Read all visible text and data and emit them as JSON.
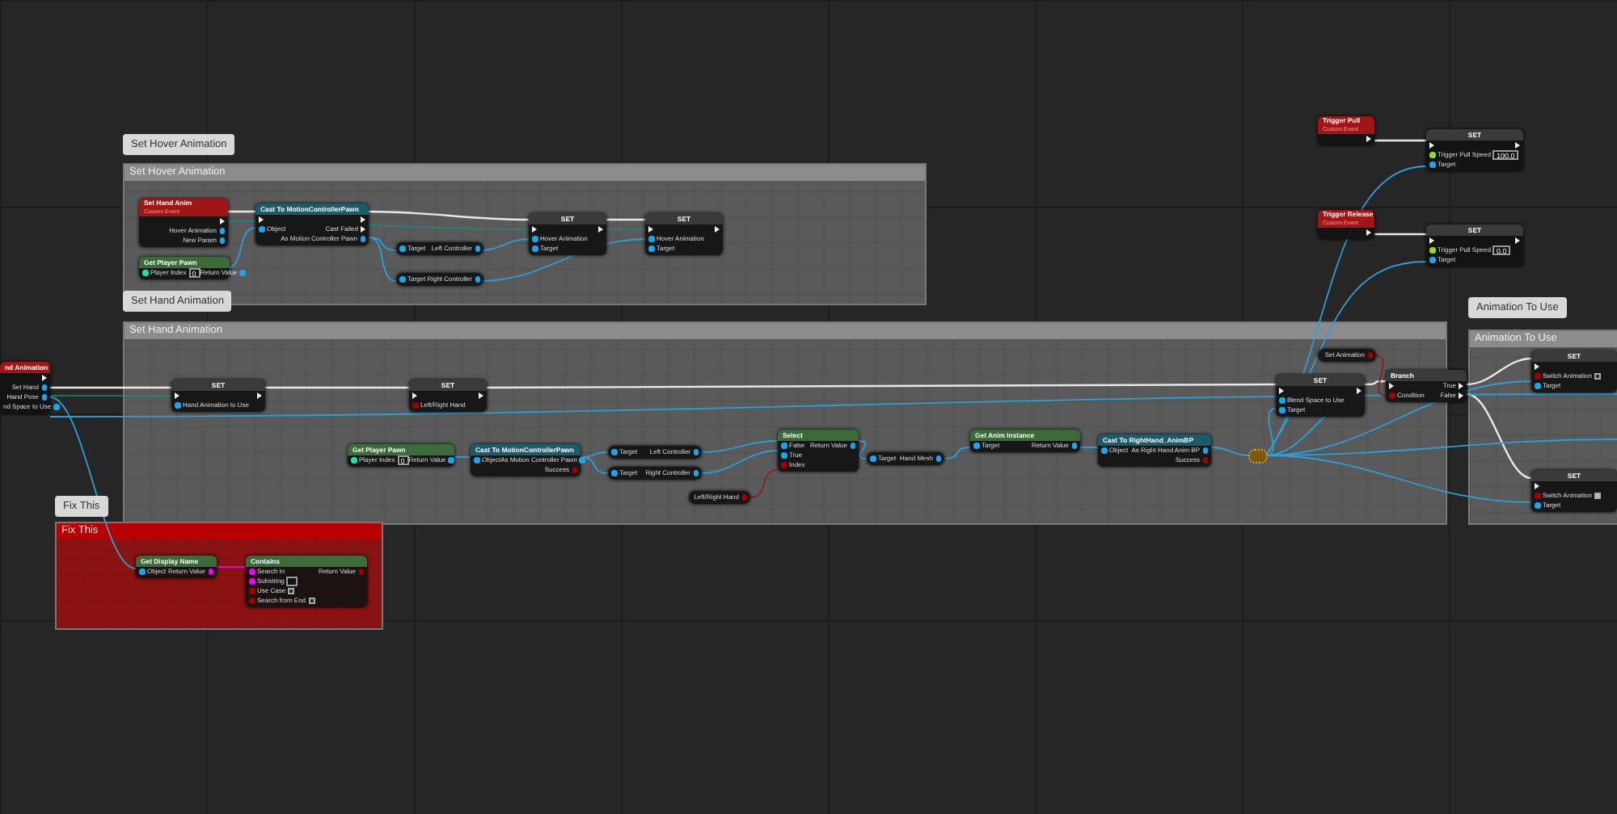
{
  "comments": [
    {
      "title": "Set Hover Animation",
      "bubble": "Set Hover Animation",
      "color": "#5a5a5a"
    },
    {
      "title": "Set Hand Animation",
      "bubble": "Set Hand Animation",
      "color": "#5a5a5a"
    },
    {
      "title": "Fix This",
      "bubble": "Fix This",
      "color": "#8a1212"
    },
    {
      "title": "Animation To Use",
      "bubble": "Animation To Use",
      "color": "#5a5a5a"
    }
  ],
  "nodes": [
    {
      "kind": "event",
      "title": "Set Hand Anim",
      "subtitle": "Custom Event",
      "selected": false,
      "outputs": [
        {
          "kind": "exec"
        },
        {
          "label": "Hover Animation",
          "kind": "object"
        },
        {
          "label": "New Param",
          "kind": "object"
        }
      ]
    },
    {
      "kind": "pure",
      "title": "Get Player Pawn",
      "selected": false,
      "inputs": [
        {
          "label": "Player Index",
          "kind": "int",
          "value": "0"
        }
      ],
      "outputs": [
        {
          "label": "Return Value",
          "kind": "object"
        }
      ]
    },
    {
      "kind": "cast",
      "title": "Cast To MotionControllerPawn",
      "selected": false,
      "inputs": [
        {
          "kind": "exec"
        },
        {
          "label": "Object",
          "kind": "object"
        }
      ],
      "outputs": [
        {
          "kind": "exec"
        },
        {
          "label": "Cast Failed",
          "kind": "exec"
        },
        {
          "label": "As Motion Controller Pawn",
          "kind": "object"
        }
      ]
    },
    {
      "kind": "getter",
      "selected": false,
      "inputs": [
        {
          "label": "Target",
          "kind": "object"
        }
      ],
      "outputs": [
        {
          "label": "Left Controller",
          "kind": "object"
        }
      ]
    },
    {
      "kind": "getter",
      "selected": false,
      "inputs": [
        {
          "label": "Target",
          "kind": "object"
        }
      ],
      "outputs": [
        {
          "label": "Right Controller",
          "kind": "object"
        }
      ]
    },
    {
      "kind": "set",
      "title": "SET",
      "selected": false,
      "inputs": [
        {
          "kind": "exec"
        },
        {
          "label": "Hover Animation",
          "kind": "object"
        },
        {
          "label": "Target",
          "kind": "object"
        }
      ],
      "outputs": [
        {
          "kind": "exec"
        }
      ]
    },
    {
      "kind": "set",
      "title": "SET",
      "selected": false,
      "inputs": [
        {
          "kind": "exec"
        },
        {
          "label": "Hover Animation",
          "kind": "object"
        },
        {
          "label": "Target",
          "kind": "object"
        }
      ],
      "outputs": [
        {
          "kind": "exec"
        }
      ]
    },
    {
      "kind": "event",
      "title": "nd Animation",
      "selected": false,
      "outputs": [
        {
          "kind": "exec"
        },
        {
          "label": "Set Hand",
          "kind": "object"
        },
        {
          "label": "Hand Pose",
          "kind": "object"
        },
        {
          "label": "nd Space to Use",
          "kind": "object"
        }
      ]
    },
    {
      "kind": "set",
      "title": "SET",
      "selected": false,
      "inputs": [
        {
          "kind": "exec"
        },
        {
          "label": "Hand Animation to Use",
          "kind": "object"
        }
      ],
      "outputs": [
        {
          "kind": "exec"
        }
      ]
    },
    {
      "kind": "set",
      "title": "SET",
      "selected": false,
      "inputs": [
        {
          "kind": "exec"
        },
        {
          "label": "Left/Right Hand",
          "kind": "bool"
        }
      ],
      "outputs": [
        {
          "kind": "exec"
        }
      ]
    },
    {
      "kind": "pure",
      "title": "Get Player Pawn",
      "selected": false,
      "inputs": [
        {
          "label": "Player Index",
          "kind": "int",
          "value": "0"
        }
      ],
      "outputs": [
        {
          "label": "Return Value",
          "kind": "object"
        }
      ]
    },
    {
      "kind": "cast",
      "title": "Cast To MotionControllerPawn",
      "selected": false,
      "inputs": [
        {
          "label": "Object",
          "kind": "object"
        }
      ],
      "outputs": [
        {
          "label": "As Motion Controller Pawn",
          "kind": "object"
        },
        {
          "label": "Success",
          "kind": "bool"
        }
      ]
    },
    {
      "kind": "getter",
      "selected": false,
      "inputs": [
        {
          "label": "Target",
          "kind": "object"
        }
      ],
      "outputs": [
        {
          "label": "Left Controller",
          "kind": "object"
        }
      ]
    },
    {
      "kind": "getter",
      "selected": false,
      "inputs": [
        {
          "label": "Target",
          "kind": "object"
        }
      ],
      "outputs": [
        {
          "label": "Right Controller",
          "kind": "object"
        }
      ]
    },
    {
      "kind": "getter",
      "selected": false,
      "outputs": [
        {
          "label": "Left/Right Hand",
          "kind": "bool"
        }
      ]
    },
    {
      "kind": "pure",
      "title": "Select",
      "selected": false,
      "inputs": [
        {
          "label": "False",
          "kind": "object"
        },
        {
          "label": "True",
          "kind": "object"
        },
        {
          "label": "Index",
          "kind": "bool"
        }
      ],
      "outputs": [
        {
          "label": "Return Value",
          "kind": "object"
        }
      ]
    },
    {
      "kind": "getter",
      "selected": false,
      "inputs": [
        {
          "label": "Target",
          "kind": "object"
        }
      ],
      "outputs": [
        {
          "label": "Hand Mesh",
          "kind": "object"
        }
      ]
    },
    {
      "kind": "pure",
      "title": "Get Anim Instance",
      "selected": false,
      "inputs": [
        {
          "label": "Target",
          "kind": "object"
        }
      ],
      "outputs": [
        {
          "label": "Return Value",
          "kind": "object"
        }
      ]
    },
    {
      "kind": "cast",
      "title": "Cast To RightHand_AnimBP",
      "selected": false,
      "inputs": [
        {
          "label": "Object",
          "kind": "object"
        }
      ],
      "outputs": [
        {
          "label": "As Right Hand Anim BP",
          "kind": "object"
        },
        {
          "label": "Success",
          "kind": "bool"
        }
      ]
    },
    {
      "kind": "reroute",
      "selected": true
    },
    {
      "kind": "getter",
      "selected": false,
      "outputs": [
        {
          "label": "Set Animation",
          "kind": "bool"
        }
      ]
    },
    {
      "kind": "set",
      "title": "SET",
      "selected": false,
      "inputs": [
        {
          "kind": "exec"
        },
        {
          "label": "Blend Space to Use",
          "kind": "object"
        },
        {
          "label": "Target",
          "kind": "object"
        }
      ],
      "outputs": [
        {
          "kind": "exec"
        }
      ]
    },
    {
      "kind": "branch",
      "title": "Branch",
      "selected": false,
      "inputs": [
        {
          "kind": "exec"
        },
        {
          "label": "Condition",
          "kind": "bool"
        }
      ],
      "outputs": [
        {
          "label": "True",
          "kind": "exec"
        },
        {
          "label": "False",
          "kind": "exec"
        }
      ]
    },
    {
      "kind": "set",
      "title": "SET",
      "selected": false,
      "inputs": [
        {
          "kind": "exec"
        },
        {
          "label": "Switch Animation",
          "kind": "bool",
          "checked": false
        },
        {
          "label": "Target",
          "kind": "object"
        }
      ]
    },
    {
      "kind": "set",
      "title": "SET",
      "selected": false,
      "inputs": [
        {
          "kind": "exec"
        },
        {
          "label": "Switch Animation",
          "kind": "bool",
          "checked": true
        },
        {
          "label": "Target",
          "kind": "object"
        }
      ]
    },
    {
      "kind": "event",
      "title": "Trigger Pull",
      "subtitle": "Custom Event",
      "selected": false,
      "outputs": [
        {
          "kind": "exec"
        }
      ]
    },
    {
      "kind": "set",
      "title": "SET",
      "selected": false,
      "inputs": [
        {
          "kind": "exec"
        },
        {
          "label": "Trigger Pull Speed",
          "kind": "float",
          "value": "100.0"
        },
        {
          "label": "Target",
          "kind": "object"
        }
      ],
      "outputs": [
        {
          "kind": "exec"
        }
      ]
    },
    {
      "kind": "event",
      "title": "Trigger Release",
      "subtitle": "Custom Event",
      "selected": false,
      "outputs": [
        {
          "kind": "exec"
        }
      ]
    },
    {
      "kind": "set",
      "title": "SET",
      "selected": false,
      "inputs": [
        {
          "kind": "exec"
        },
        {
          "label": "Trigger Pull Speed",
          "kind": "float",
          "value": "0.0"
        },
        {
          "label": "Target",
          "kind": "object"
        }
      ],
      "outputs": [
        {
          "kind": "exec"
        }
      ]
    },
    {
      "kind": "pure",
      "title": "Get Display Name",
      "selected": false,
      "inputs": [
        {
          "label": "Object",
          "kind": "object"
        }
      ],
      "outputs": [
        {
          "label": "Return Value",
          "kind": "string"
        }
      ]
    },
    {
      "kind": "pure",
      "title": "Contains",
      "selected": false,
      "inputs": [
        {
          "label": "Search In",
          "kind": "string"
        },
        {
          "label": "Substring",
          "kind": "string",
          "field": true
        },
        {
          "label": "Use Case",
          "kind": "bool",
          "checked": false
        },
        {
          "label": "Search from End",
          "kind": "bool",
          "checked": false
        }
      ],
      "outputs": [
        {
          "label": "Return Value",
          "kind": "bool"
        }
      ]
    }
  ]
}
